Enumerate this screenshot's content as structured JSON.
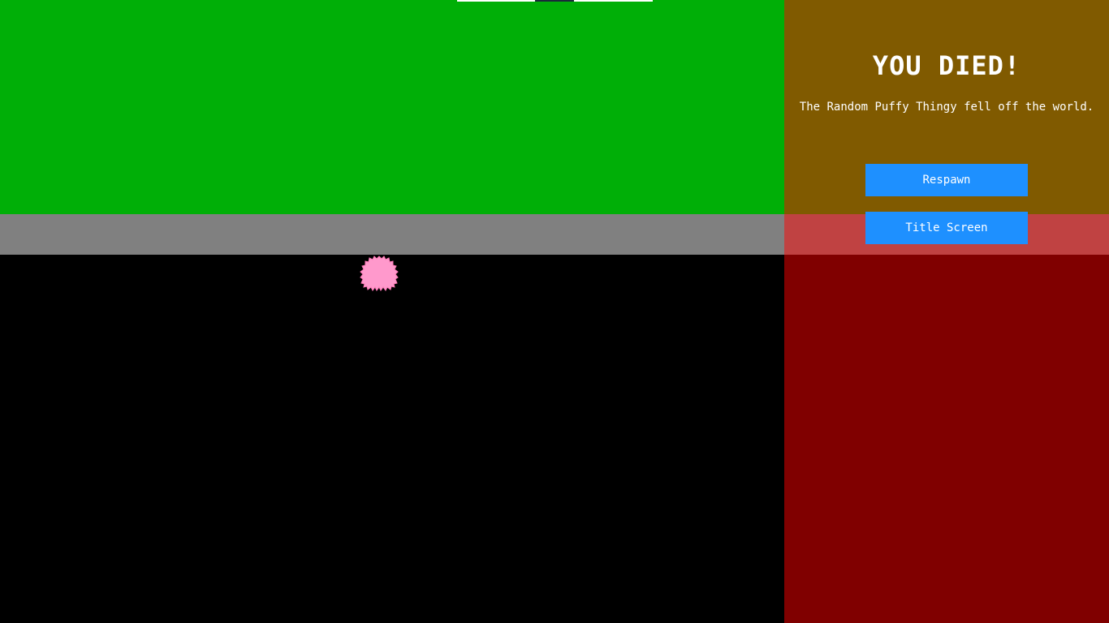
{
  "death_screen": {
    "title": "YOU DIED!",
    "message": "The Random Puffy Thingy fell off the world.",
    "respawn_label": "Respawn",
    "title_screen_label": "Title Screen"
  },
  "colors": {
    "sky": "#00af07",
    "ground": "#808080",
    "void": "#000000",
    "overlay_top": "#805a00",
    "overlay_mid": "#c04242",
    "overlay_bottom": "#800000",
    "button": "#1e90ff",
    "puffy": "#ff99cc"
  },
  "player": {
    "name_icon": "puffy-creature-icon"
  }
}
